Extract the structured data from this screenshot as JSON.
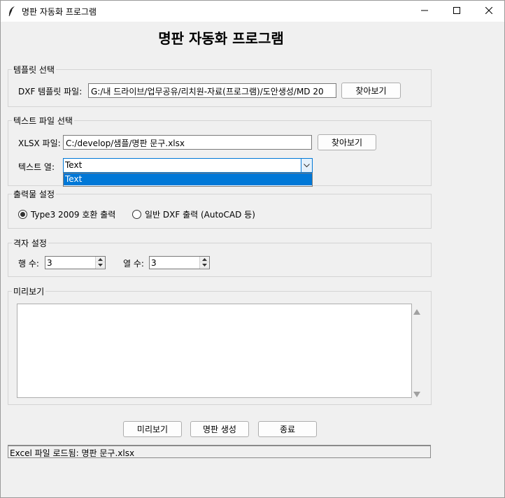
{
  "window": {
    "title": "명판 자동화 프로그램"
  },
  "heading": "명판 자동화 프로그램",
  "template_section": {
    "legend": "템플릿 선택",
    "label": "DXF 템플릿 파일:",
    "value": "G:/내 드라이브/업무공유/리치원-자료(프로그램)/도안생성/MD 20",
    "browse_label": "찾아보기"
  },
  "text_file_section": {
    "legend": "텍스트 파일 선택",
    "xlsx_label": "XLSX 파일:",
    "xlsx_value": "C:/develop/샘플/명판 문구.xlsx",
    "browse_label": "찾아보기",
    "column_label": "텍스트 열:",
    "column_selected": "Text",
    "column_options": [
      "Text"
    ]
  },
  "output_section": {
    "legend": "출력물 설정",
    "options": [
      "Type3 2009 호환 출력",
      "일반 DXF 출력 (AutoCAD 등)"
    ],
    "selected_index": 0
  },
  "grid_section": {
    "legend": "격자 설정",
    "rows_label": "행 수:",
    "rows_value": "3",
    "cols_label": "열 수:",
    "cols_value": "3"
  },
  "preview_section": {
    "legend": "미리보기"
  },
  "actions": {
    "preview_label": "미리보기",
    "generate_label": "명판 생성",
    "exit_label": "종료"
  },
  "status_text": "Excel 파일 로드됨: 명판 문구.xlsx",
  "colors": {
    "accent": "#0078d7",
    "background": "#f0f0f0"
  }
}
